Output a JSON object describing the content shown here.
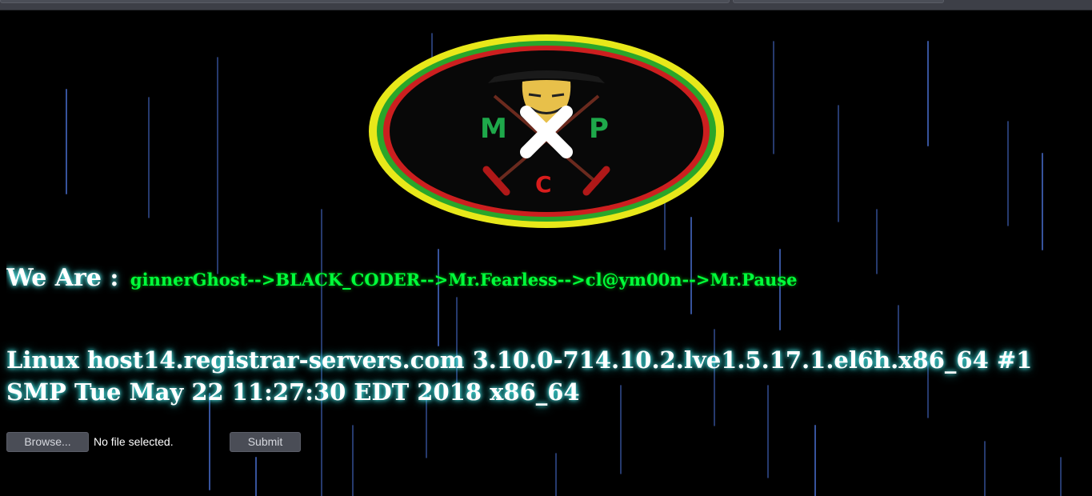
{
  "browser": {
    "chrome": "toolbar"
  },
  "logo": {
    "letters": [
      "M",
      "P",
      "C"
    ],
    "colors": {
      "outer_ring": "#e8e81a",
      "middle_ring": "#2aa62a",
      "inner_ring": "#cc1f1f",
      "letters": "#1ea84a",
      "letter_c": "#d81c1c"
    }
  },
  "team": {
    "prefix": "We Are :",
    "names": "ginnerGhost-->BLACK_CODER-->Mr.Fearless-->cl@ym00n-->Mr.Pause"
  },
  "system": {
    "uname": "Linux host14.registrar-servers.com 3.10.0-714.10.2.lve1.5.17.1.el6h.x86_64 #1 SMP Tue May 22 11:27:30 EDT 2018 x86_64"
  },
  "upload": {
    "browse_label": "Browse...",
    "file_status": "No file selected.",
    "submit_label": "Submit"
  },
  "colors": {
    "background": "#000000",
    "rain": "#4a6fd0",
    "names_text": "#00ff3c",
    "glow": "#55ffff"
  }
}
